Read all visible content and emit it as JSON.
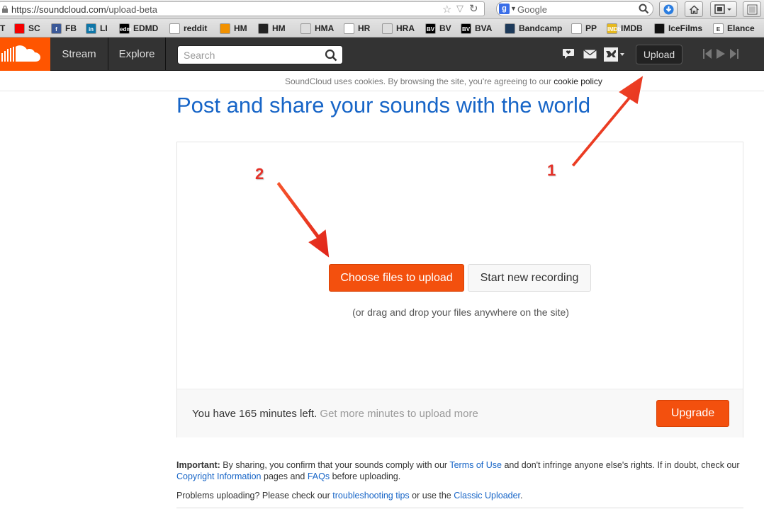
{
  "browser": {
    "url_host": "https://soundcloud.com",
    "url_path": "/upload-beta",
    "search_placeholder": "Google",
    "google_letter": "g"
  },
  "bookmarks": [
    {
      "label": "T",
      "color": "#000000",
      "glyph": ""
    },
    {
      "label": "SC",
      "color": "#f50000",
      "glyph": ""
    },
    {
      "label": "FB",
      "color": "#3b5998",
      "glyph": "f"
    },
    {
      "label": "LI",
      "color": "#0e76a8",
      "glyph": "in"
    },
    {
      "label": "EDMD",
      "color": "#000000",
      "glyph": "edm"
    },
    {
      "label": "reddit",
      "color": "#ffffff",
      "glyph": ""
    },
    {
      "label": "HM",
      "color": "#f29100",
      "glyph": ""
    },
    {
      "label": "HM",
      "color": "#222222",
      "glyph": ""
    },
    {
      "label": "HMA",
      "color": "#dddddd",
      "glyph": ""
    },
    {
      "label": "HR",
      "color": "#ffffff",
      "glyph": ""
    },
    {
      "label": "HRA",
      "color": "#dddddd",
      "glyph": ""
    },
    {
      "label": "BV",
      "color": "#000000",
      "glyph": "BV"
    },
    {
      "label": "BVA",
      "color": "#000000",
      "glyph": "BV"
    },
    {
      "label": "Bandcamp",
      "color": "#1d3a5a",
      "glyph": ""
    },
    {
      "label": "PP",
      "color": "#ffffff",
      "glyph": ""
    },
    {
      "label": "IMDB",
      "color": "#e6b91e",
      "glyph": "IMDb"
    },
    {
      "label": "IceFilms",
      "color": "#111111",
      "glyph": ""
    },
    {
      "label": "Elance",
      "color": "#ffffff",
      "glyph": "E"
    }
  ],
  "header": {
    "nav": [
      "Stream",
      "Explore"
    ],
    "search_placeholder": "Search",
    "upload_label": "Upload"
  },
  "cookie": {
    "text": "SoundCloud uses cookies. By browsing the site, you're agreeing to our ",
    "link": "cookie policy"
  },
  "page": {
    "title": "Post and share your sounds with the world"
  },
  "upload": {
    "choose_label": "Choose files to upload",
    "record_label": "Start new recording",
    "drag_hint": "(or drag and drop your files anywhere on the site)",
    "minutes_text": "You have 165 minutes left.",
    "more_minutes_text": "Get more minutes to upload more",
    "upgrade_label": "Upgrade"
  },
  "legal": {
    "important": "Important:",
    "p1_a": " By sharing, you confirm that your sounds comply with our ",
    "terms": "Terms of Use",
    "p1_b": " and don't infringe anyone else's rights. If in doubt, check our ",
    "copyright": "Copyright Information",
    "p1_c": " pages and ",
    "faqs": "FAQs",
    "p1_d": " before uploading.",
    "p2_a": "Problems uploading? Please check our ",
    "tips": "troubleshooting tips",
    "p2_b": " or use the ",
    "classic": "Classic Uploader",
    "p2_c": "."
  },
  "annotations": {
    "one": "1",
    "two": "2"
  },
  "colors": {
    "brand": "#ff5500",
    "link": "#1765c7",
    "arrow": "#f03e1e"
  }
}
